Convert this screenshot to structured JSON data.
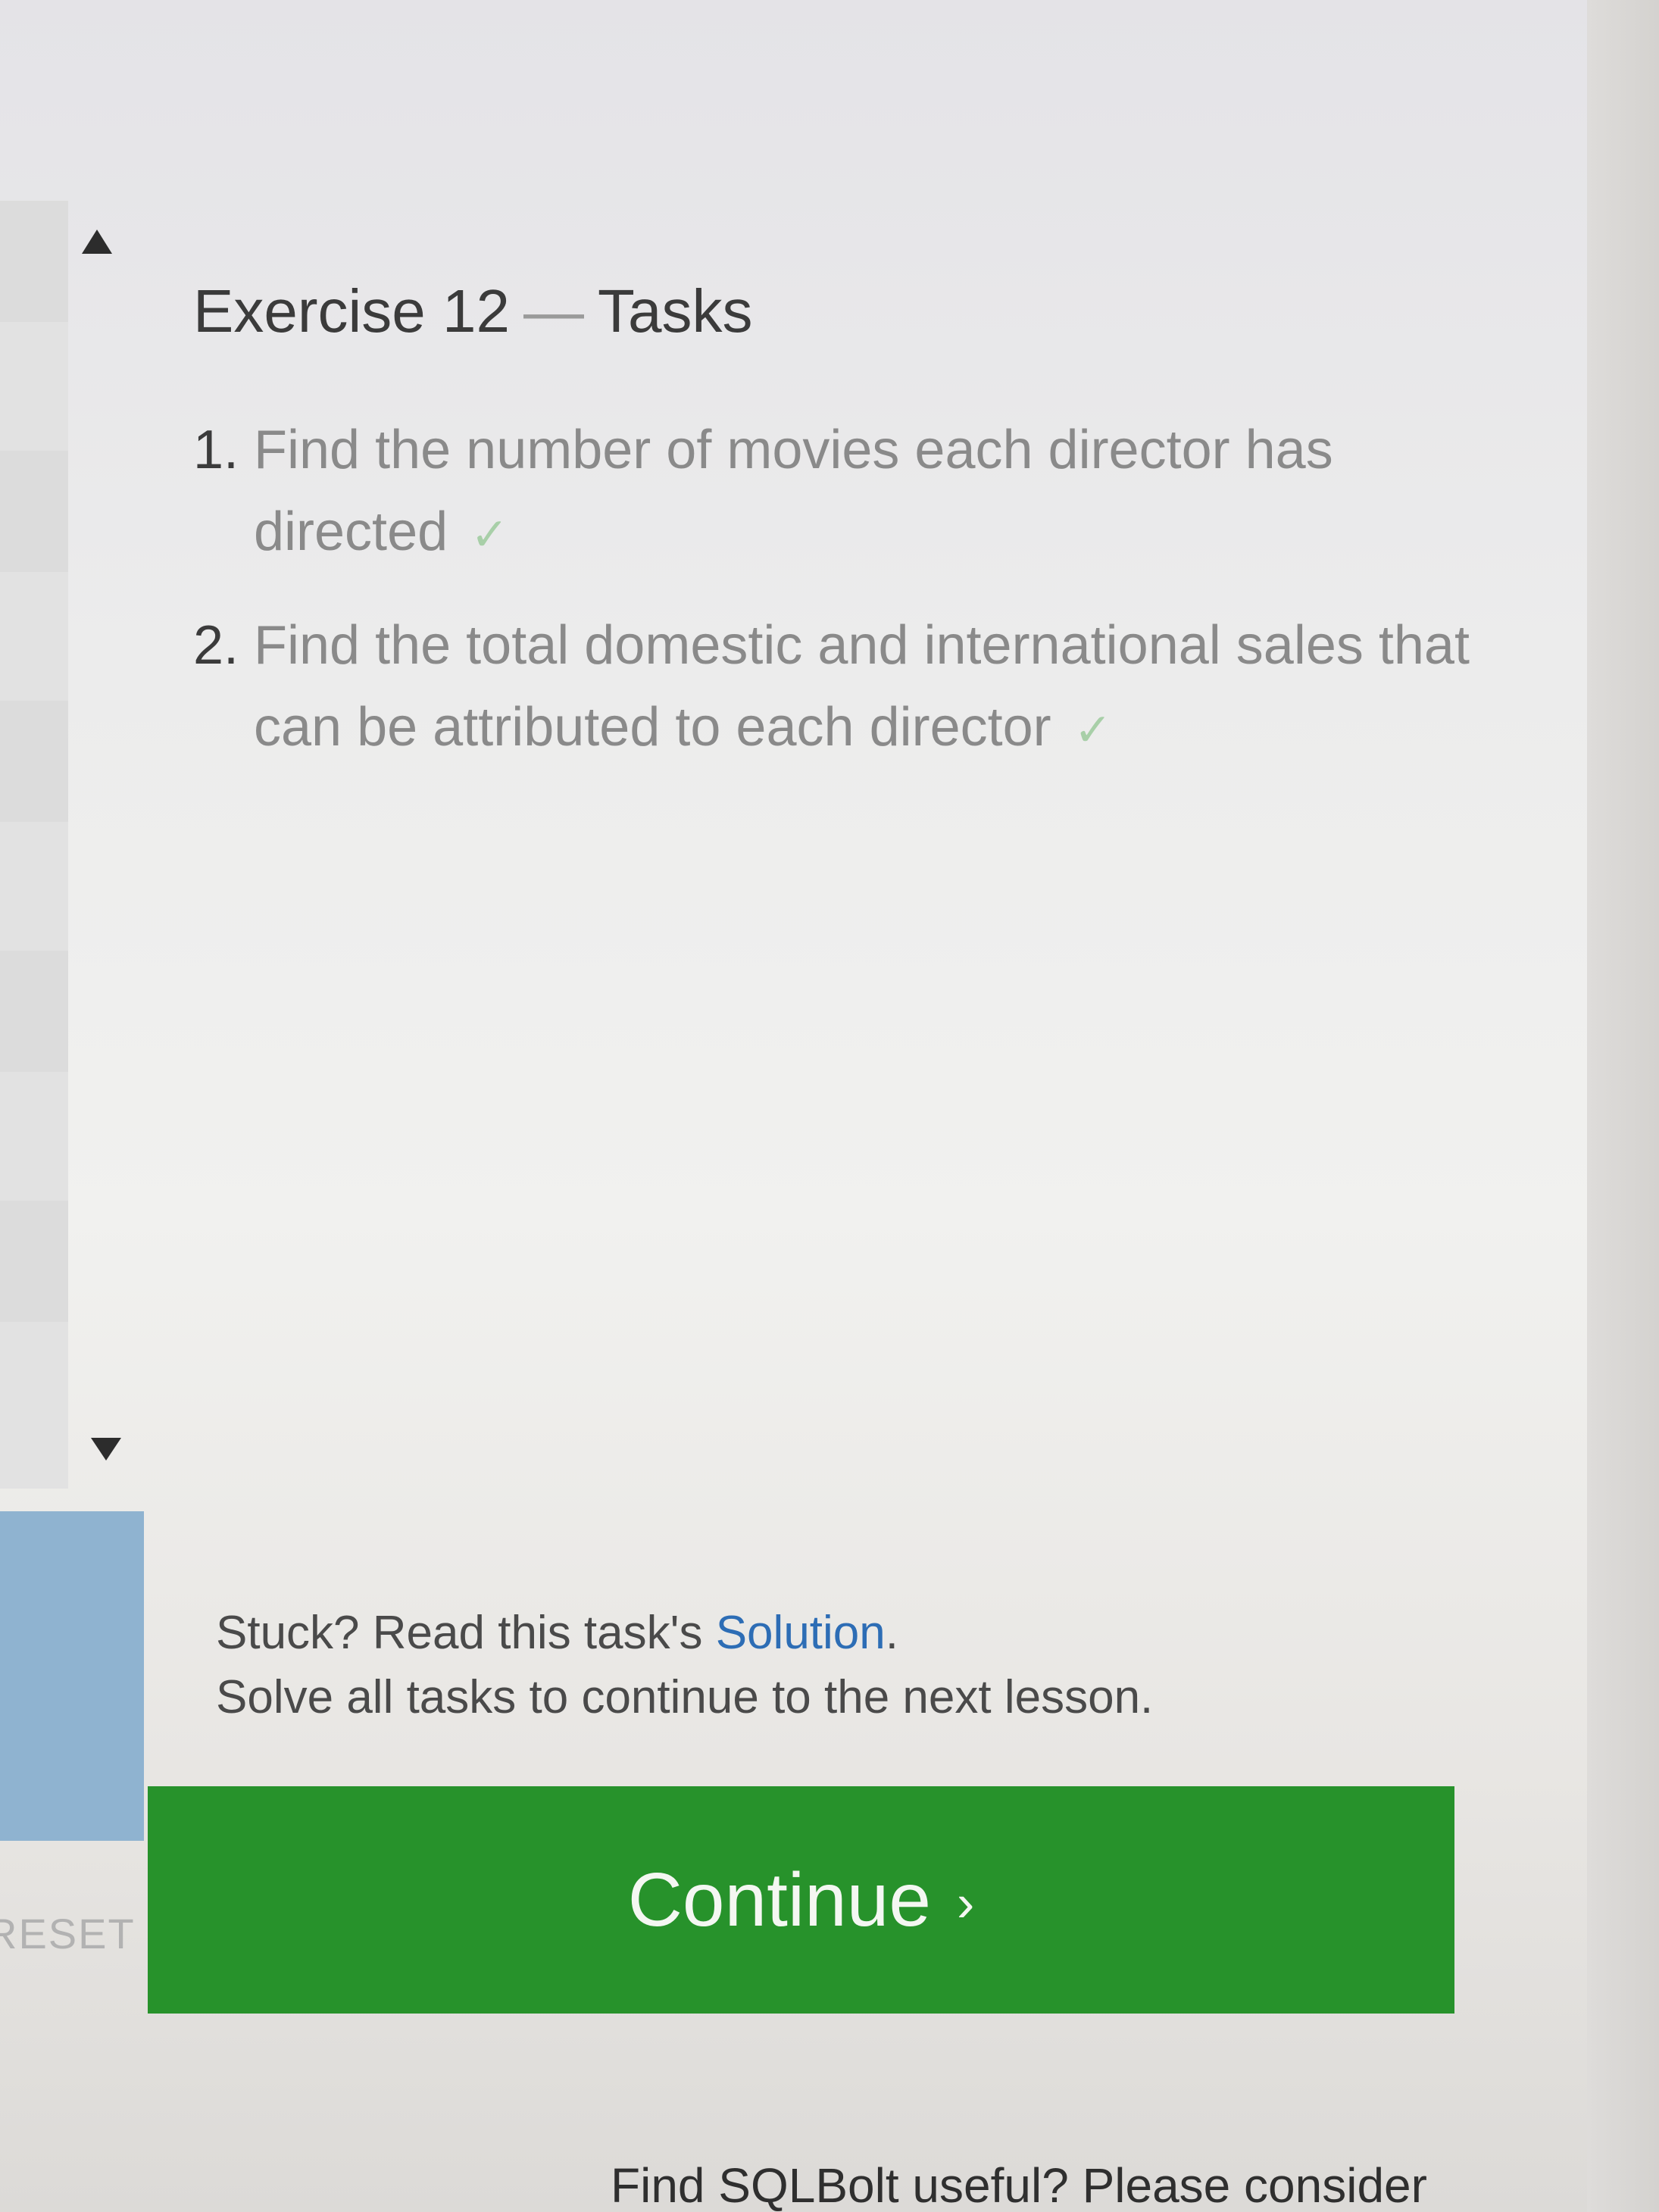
{
  "exercise": {
    "title_prefix": "Exercise 12",
    "title_sep": "—",
    "title_suffix": "Tasks"
  },
  "tasks": [
    {
      "number": "1.",
      "text": "Find the number of movies each director has directed",
      "check": "✓"
    },
    {
      "number": "2.",
      "text": "Find the total domestic and international sales that can be attributed to each director",
      "check": "✓"
    }
  ],
  "help": {
    "stuck_prefix": "Stuck? Read this task's ",
    "solution_link": "Solution",
    "stuck_suffix": ".",
    "solve_note": "Solve all tasks to continue to the next lesson."
  },
  "continue_button": {
    "label": "Continue",
    "chevron": "›"
  },
  "editor": {
    "reset_label": "RESET"
  },
  "footer": {
    "text": "Find SQLBolt useful? Please consider"
  },
  "colors": {
    "continue_green": "#27922b",
    "link_blue": "#2d6db5",
    "check_green": "#a8cfa8"
  }
}
